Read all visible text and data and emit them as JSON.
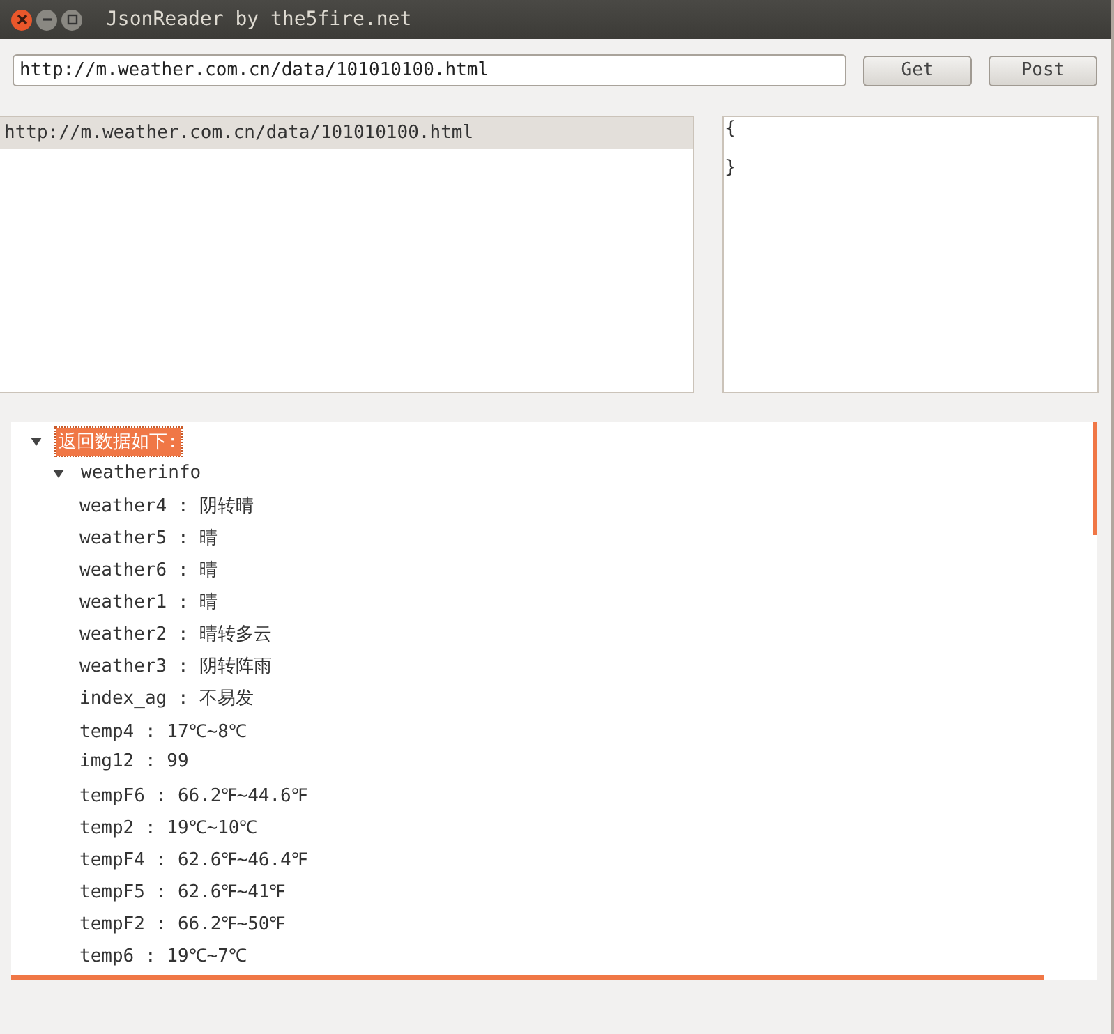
{
  "window": {
    "title": "JsonReader by the5fire.net"
  },
  "url_field": {
    "value": "http://m.weather.com.cn/data/101010100.html"
  },
  "buttons": [
    "Get",
    "Post"
  ],
  "history": [
    {
      "label": "http://m.weather.com.cn/data/101010100.html",
      "selected": true
    }
  ],
  "json_text": "{\n\n}",
  "tree": [
    {
      "label": "返回数据如下:",
      "selected": true,
      "expanded": true,
      "children": [
        {
          "label": "weatherinfo",
          "selected": false,
          "expanded": true,
          "children": [
            {
              "label": "weather4 : 阴转晴"
            },
            {
              "label": "weather5 : 晴"
            },
            {
              "label": "weather6 : 晴"
            },
            {
              "label": "weather1 : 晴"
            },
            {
              "label": "weather2 : 晴转多云"
            },
            {
              "label": "weather3 : 阴转阵雨"
            },
            {
              "label": "index_ag : 不易发"
            },
            {
              "label": "temp4 : 17℃~8℃"
            },
            {
              "label": "img12 : 99"
            },
            {
              "label": "tempF6 : 66.2℉~44.6℉"
            },
            {
              "label": "temp2 : 19℃~10℃"
            },
            {
              "label": "tempF4 : 62.6℉~46.4℉"
            },
            {
              "label": "tempF5 : 62.6℉~41℉"
            },
            {
              "label": "tempF2 : 66.2℉~50℉"
            },
            {
              "label": "temp6 : 19℃~7℃"
            }
          ]
        }
      ]
    }
  ]
}
